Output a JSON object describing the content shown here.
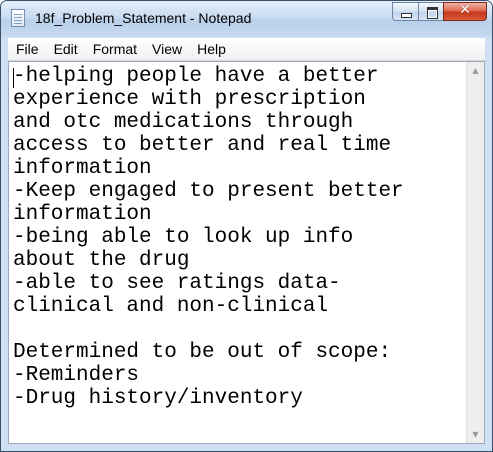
{
  "window": {
    "title": "18f_Problem_Statement - Notepad"
  },
  "caption_buttons": {
    "minimize_icon": "minimize-icon",
    "maximize_icon": "maximize-icon",
    "close_glyph": "✕"
  },
  "menu": {
    "items": [
      {
        "label": "File"
      },
      {
        "label": "Edit"
      },
      {
        "label": "Format"
      },
      {
        "label": "View"
      },
      {
        "label": "Help"
      }
    ]
  },
  "document": {
    "text": "-helping people have a better\nexperience with prescription\nand otc medications through\naccess to better and real time\ninformation\n-Keep engaged to present better\ninformation\n-being able to look up info\nabout the drug\n-able to see ratings data-\nclinical and non-clinical\n\nDetermined to be out of scope:\n-Reminders\n-Drug history/inventory"
  },
  "scrollbar": {
    "up_arrow": "▲",
    "down_arrow": "▼"
  }
}
